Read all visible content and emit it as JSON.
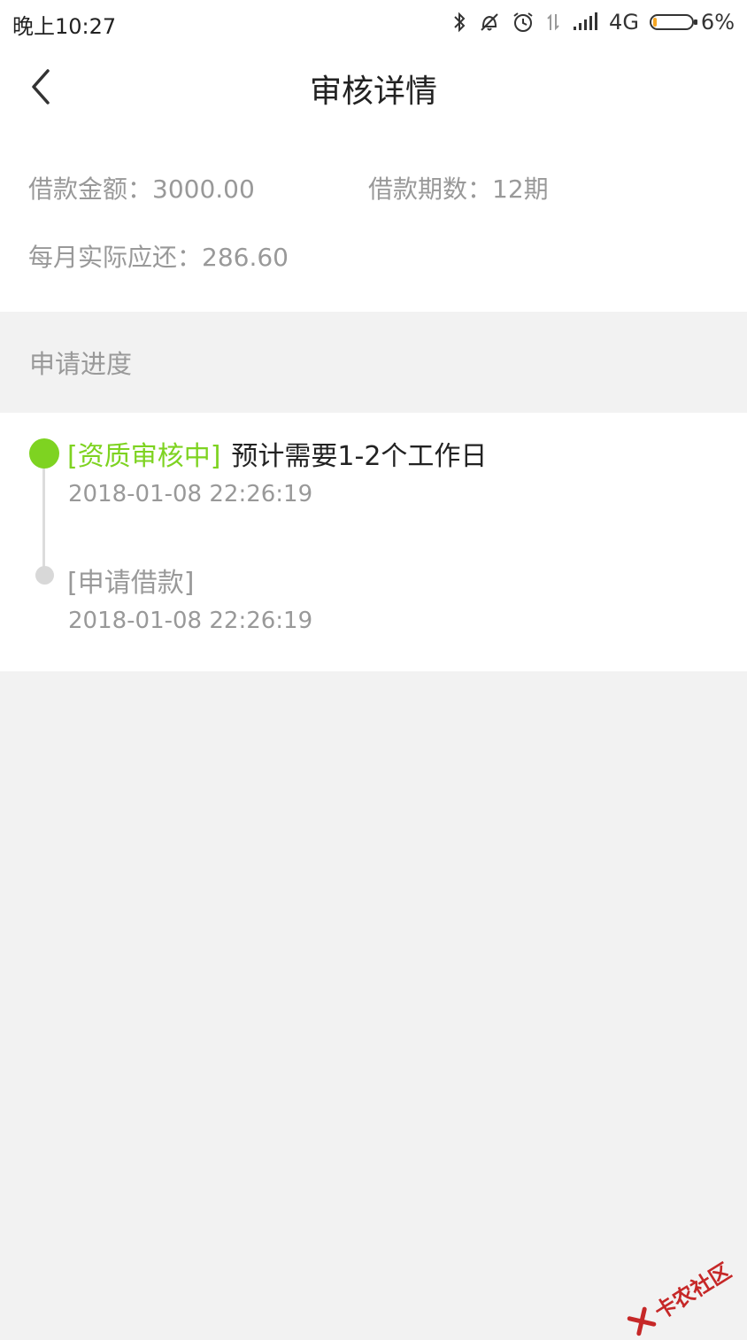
{
  "status_bar": {
    "time": "晚上10:27",
    "network": "4G",
    "battery_percent": "6%",
    "battery_level": 0.06,
    "icons": [
      "bluetooth-icon",
      "silent-bell-icon",
      "alarm-icon",
      "data-transfer-icon",
      "signal-icon",
      "battery-icon"
    ]
  },
  "header": {
    "title": "审核详情",
    "back_icon": "chevron-left-icon"
  },
  "summary": {
    "amount": "借款金额：3000.00",
    "periods": "借款期数：12期",
    "monthly": "每月实际应还：286.60"
  },
  "progress": {
    "section_title": "申请进度",
    "steps": [
      {
        "status": "[资质审核中]",
        "description": "预计需要1-2个工作日",
        "time": "2018-01-08 22:26:19",
        "active": true
      },
      {
        "status": "[申请借款]",
        "description": "",
        "time": "2018-01-08 22:26:19",
        "active": false
      }
    ]
  },
  "watermark": {
    "text": "卡农社区"
  },
  "colors": {
    "accent_green": "#7ed321",
    "muted_text": "#999999",
    "primary_text": "#222222",
    "background": "#f2f2f2",
    "battery_fill": "#f5a623"
  }
}
